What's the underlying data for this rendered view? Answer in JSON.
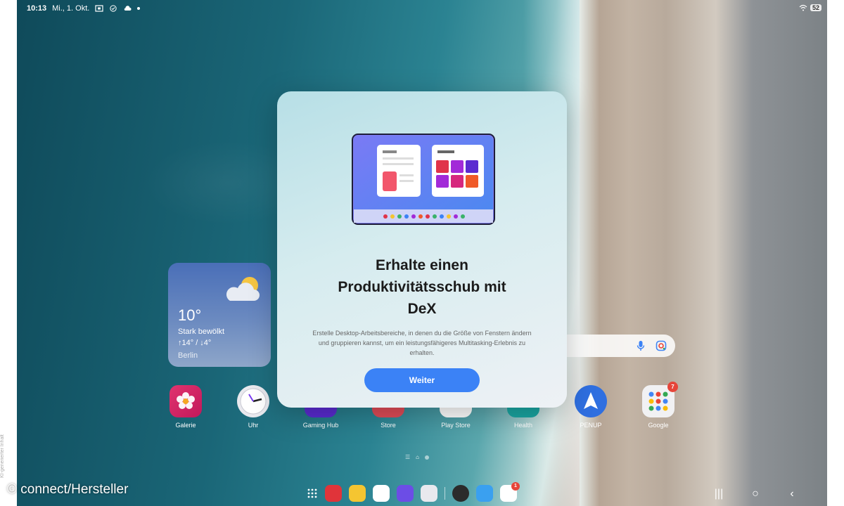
{
  "status_bar": {
    "time": "10:13",
    "date": "Mi., 1. Okt.",
    "battery": "52"
  },
  "weather": {
    "temperature": "10°",
    "condition": "Stark bewölkt",
    "range": "↑14° / ↓4°",
    "city": "Berlin"
  },
  "apps": [
    {
      "label": "Galerie",
      "color": "#e0336e"
    },
    {
      "label": "Uhr",
      "color": "#e9e9ee"
    },
    {
      "label": "Gaming Hub",
      "color": "#5a2bd1"
    },
    {
      "label": "Store",
      "color": "#e04c58"
    },
    {
      "label": "Play Store",
      "color": "#ffffff"
    },
    {
      "label": "Health",
      "color": "#1aa6a2"
    },
    {
      "label": "PENUP",
      "color": "#2f6fe0"
    },
    {
      "label": "Google",
      "color": "#f1f1f3",
      "badge": "7"
    }
  ],
  "taskbar": {
    "play_badge": "1"
  },
  "dialog": {
    "title_line1": "Erhalte einen",
    "title_line2": "Produktivitätsschub mit",
    "title_line3": "DeX",
    "description": "Erstelle Desktop-Arbeitsbereiche, in denen du die Größe von Fenstern ändern und gruppieren kannst, um ein leistungsfähigeres Multitasking-Erlebnis zu erhalten.",
    "button_label": "Weiter"
  },
  "watermark": "© connect/Hersteller",
  "side_note": "KI-generierter Inhalt",
  "colors": {
    "accent": "#3b82f6",
    "dialog_bg": "#d6ecef"
  }
}
